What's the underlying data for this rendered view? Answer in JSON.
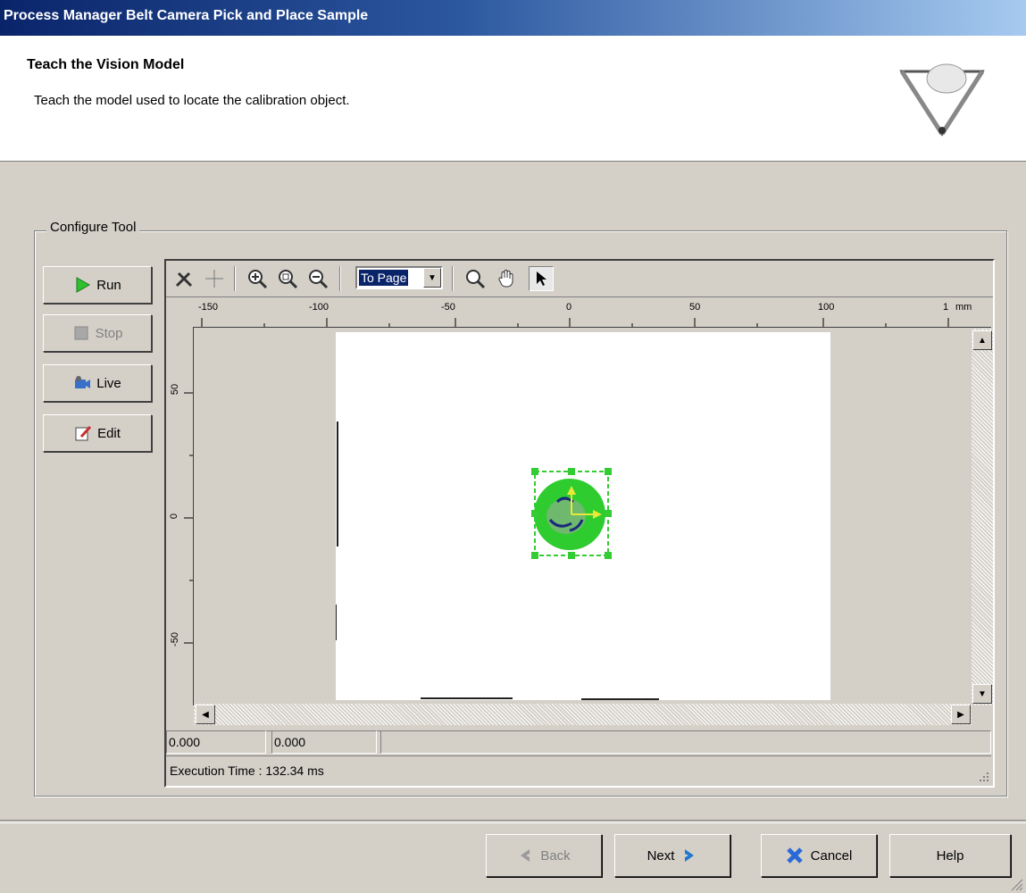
{
  "window": {
    "title": "Process Manager Belt Camera Pick and Place Sample"
  },
  "header": {
    "title": "Teach the Vision Model",
    "subtitle": "Teach the model used to locate the calibration object."
  },
  "group": {
    "label": "Configure Tool"
  },
  "side_buttons": {
    "run": "Run",
    "stop": "Stop",
    "live": "Live",
    "edit": "Edit"
  },
  "toolbar": {
    "zoom_value": "To Page"
  },
  "ruler": {
    "top_ticks": [
      "-150",
      "-100",
      "-50",
      "0",
      "50",
      "100",
      "1"
    ],
    "unit": "mm",
    "left_ticks": [
      "50",
      "0",
      "-50"
    ]
  },
  "status": {
    "x_value": "0.000",
    "y_value": "0.000",
    "execution_time": "Execution Time : 132.34 ms"
  },
  "footer": {
    "back": "Back",
    "next": "Next",
    "cancel": "Cancel",
    "help": "Help"
  },
  "colors": {
    "title_start": "#0a246a",
    "title_end": "#a6caf0",
    "model_green": "#33cc33",
    "face": "#d4d0c8"
  }
}
